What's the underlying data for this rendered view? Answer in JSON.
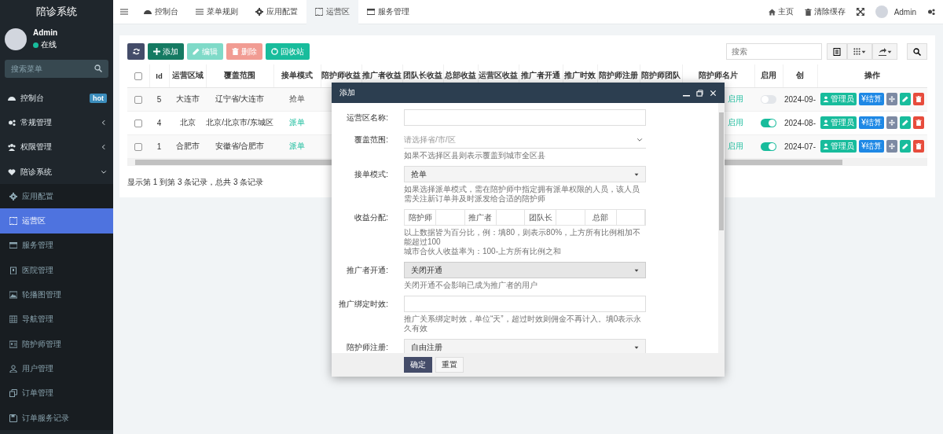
{
  "sidebar": {
    "logo": "陪诊系统",
    "user": {
      "name": "Admin",
      "status": "在线"
    },
    "search": {
      "placeholder": "搜索菜单"
    },
    "items": [
      {
        "label": "控制台",
        "badge": "hot",
        "selected": false
      },
      {
        "label": "常规管理",
        "expanded": false,
        "selected": false
      },
      {
        "label": "权限管理",
        "expanded": false,
        "selected": false
      },
      {
        "label": "陪诊系统",
        "expanded": true,
        "selected": false,
        "children": [
          {
            "label": "应用配置",
            "selected": false
          },
          {
            "label": "运营区",
            "selected": true
          },
          {
            "label": "服务管理",
            "selected": false
          },
          {
            "label": "医院管理",
            "selected": false
          },
          {
            "label": "轮播图管理",
            "selected": false
          },
          {
            "label": "导航管理",
            "selected": false
          },
          {
            "label": "陪护师管理",
            "selected": false
          },
          {
            "label": "用户管理",
            "selected": false
          },
          {
            "label": "订单管理",
            "selected": false
          },
          {
            "label": "订单服务记录",
            "selected": false
          }
        ]
      }
    ]
  },
  "topbar": {
    "tabs": [
      {
        "label": "控制台",
        "selected": false
      },
      {
        "label": "菜单规则",
        "selected": false
      },
      {
        "label": "应用配置",
        "selected": false
      },
      {
        "label": "运营区",
        "selected": true
      },
      {
        "label": "服务管理",
        "selected": false
      }
    ],
    "links": [
      "主页",
      "清除缓存"
    ],
    "user": "Admin"
  },
  "toolbar": {
    "buttons": [
      {
        "kind": "refresh",
        "disabled": false
      },
      {
        "kind": "add",
        "label": "添加",
        "disabled": false
      },
      {
        "kind": "edit",
        "label": "编辑",
        "disabled": true
      },
      {
        "kind": "delete",
        "label": "删除",
        "disabled": true
      },
      {
        "kind": "recycle",
        "label": "回收站",
        "disabled": false
      }
    ],
    "search": {
      "placeholder": "搜索"
    }
  },
  "table": {
    "all_checked": false,
    "columns": [
      "Id",
      "运营区域",
      "覆盖范围",
      "接单模式",
      "陪护师收益",
      "推广者收益",
      "团队长收益",
      "总部收益",
      "运营区收益",
      "推广者开通",
      "推广时效",
      "陪护师注册",
      "陪护师团队",
      "陪护师名片",
      "启用",
      "创",
      "操作"
    ],
    "rows": [
      {
        "checked": false,
        "id": "5",
        "region": "大连市",
        "coverage": "辽宁省/大连市",
        "mode": {
          "text": "抢单",
          "highlighted": false
        },
        "card": "启用",
        "enabled": false,
        "created": "2024-09-",
        "actions": [
          {
            "kind": "admin",
            "label": "管理员"
          },
          {
            "kind": "settle",
            "label": "¥结算"
          },
          {
            "kind": "move"
          },
          {
            "kind": "edit"
          },
          {
            "kind": "delete"
          }
        ]
      },
      {
        "checked": false,
        "id": "4",
        "region": "北京",
        "coverage": "北京/北京市/东城区",
        "mode": {
          "text": "派单",
          "highlighted": true
        },
        "card": "启用",
        "enabled": true,
        "created": "2024-08-",
        "actions": [
          {
            "kind": "admin",
            "label": "管理员"
          },
          {
            "kind": "settle",
            "label": "¥结算"
          },
          {
            "kind": "move"
          },
          {
            "kind": "edit"
          },
          {
            "kind": "delete"
          }
        ]
      },
      {
        "checked": false,
        "id": "1",
        "region": "合肥市",
        "coverage": "安徽省/合肥市",
        "mode": {
          "text": "派单",
          "highlighted": true
        },
        "card": "启用",
        "enabled": true,
        "created": "2024-07-",
        "actions": [
          {
            "kind": "admin",
            "label": "管理员"
          },
          {
            "kind": "settle",
            "label": "¥结算"
          },
          {
            "kind": "move"
          },
          {
            "kind": "edit"
          },
          {
            "kind": "delete"
          }
        ]
      }
    ],
    "summary": "显示第 1 到第 3 条记录，总共 3 条记录"
  },
  "modal": {
    "title": "添加",
    "fields": [
      {
        "kind": "text",
        "label": "运营区名称:"
      },
      {
        "kind": "region",
        "label": "覆盖范围:",
        "placeholder": "请选择省/市/区",
        "help": [
          "如果不选择区县则表示覆盖到城市全区县"
        ]
      },
      {
        "kind": "select",
        "label": "接单模式:",
        "value": "抢单",
        "help": [
          "如果选择派单模式，需在陪护师中指定拥有派单权限的人员，该人员需关注新订单并及时派发给合适的陪护师"
        ]
      },
      {
        "kind": "split",
        "label": "收益分配:",
        "parts": [
          "陪护师",
          "推广者",
          "团队长",
          "总部"
        ],
        "help": [
          "以上数据皆为百分比，例：填80，则表示80%，上方所有比例相加不能超过100",
          "城市合伙人收益率为：100-上方所有比例之和"
        ]
      },
      {
        "kind": "select",
        "label": "推广者开通:",
        "value": "关闭开通",
        "disabled": true,
        "help": [
          "关闭开通不会影响已成为推广者的用户"
        ]
      },
      {
        "kind": "text",
        "label": "推广绑定时效:",
        "help": [
          "推广关系绑定时效，单位“天”，超过时效则佣金不再计入。填0表示永久有效"
        ]
      },
      {
        "kind": "select",
        "label": "陪护师注册:",
        "value": "自由注册"
      }
    ],
    "buttons": [
      {
        "kind": "submit",
        "label": "确定"
      },
      {
        "kind": "reset",
        "label": "重置"
      }
    ]
  }
}
